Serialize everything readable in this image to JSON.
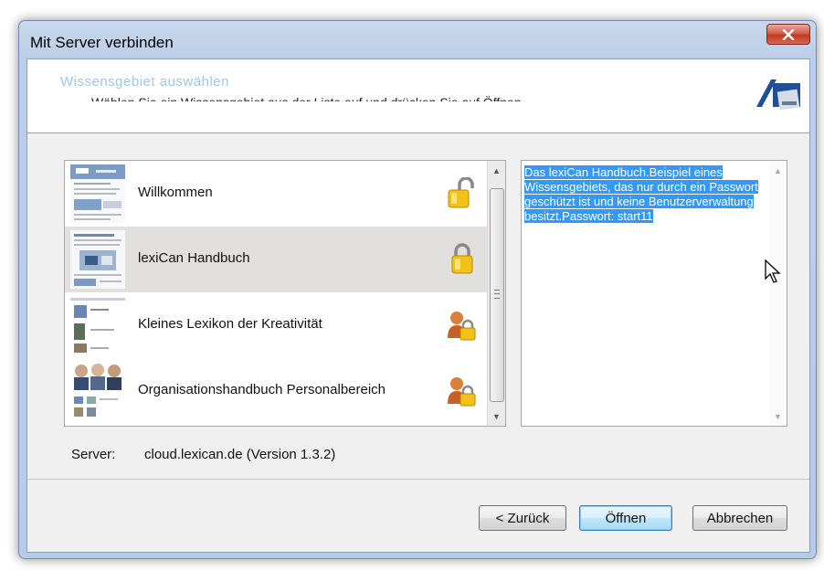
{
  "window": {
    "title": "Mit Server verbinden"
  },
  "header": {
    "title": "Wissensgebiet auswählen",
    "subtitle": "Wählen Sie ein Wissensgebiet aus der Liste auf und drücken Sie auf Öffnen."
  },
  "list": {
    "items": [
      {
        "label": "Willkommen",
        "icon": "open-lock-icon",
        "selected": false
      },
      {
        "label": "lexiCan Handbuch",
        "icon": "lock-icon",
        "selected": true
      },
      {
        "label": "Kleines Lexikon der Kreativität",
        "icon": "user-lock-icon",
        "selected": false
      },
      {
        "label": "Organisationshandbuch Personalbereich",
        "icon": "user-lock-icon",
        "selected": false
      }
    ]
  },
  "description": {
    "text": "Das lexiCan Handbuch.Beispiel eines Wissensgebiets, das nur durch ein Passwort geschützt ist und keine Benutzerverwaltung besitzt.Passwort: start11"
  },
  "server": {
    "label": "Server:",
    "value": "cloud.lexican.de (Version 1.3.2)"
  },
  "buttons": {
    "back": "< Zurück",
    "open": "Öffnen",
    "cancel": "Abbrechen"
  },
  "colors": {
    "selection": "#3399ff",
    "accent": "#9ec7e9",
    "selected_row": "#e2e0dc"
  }
}
